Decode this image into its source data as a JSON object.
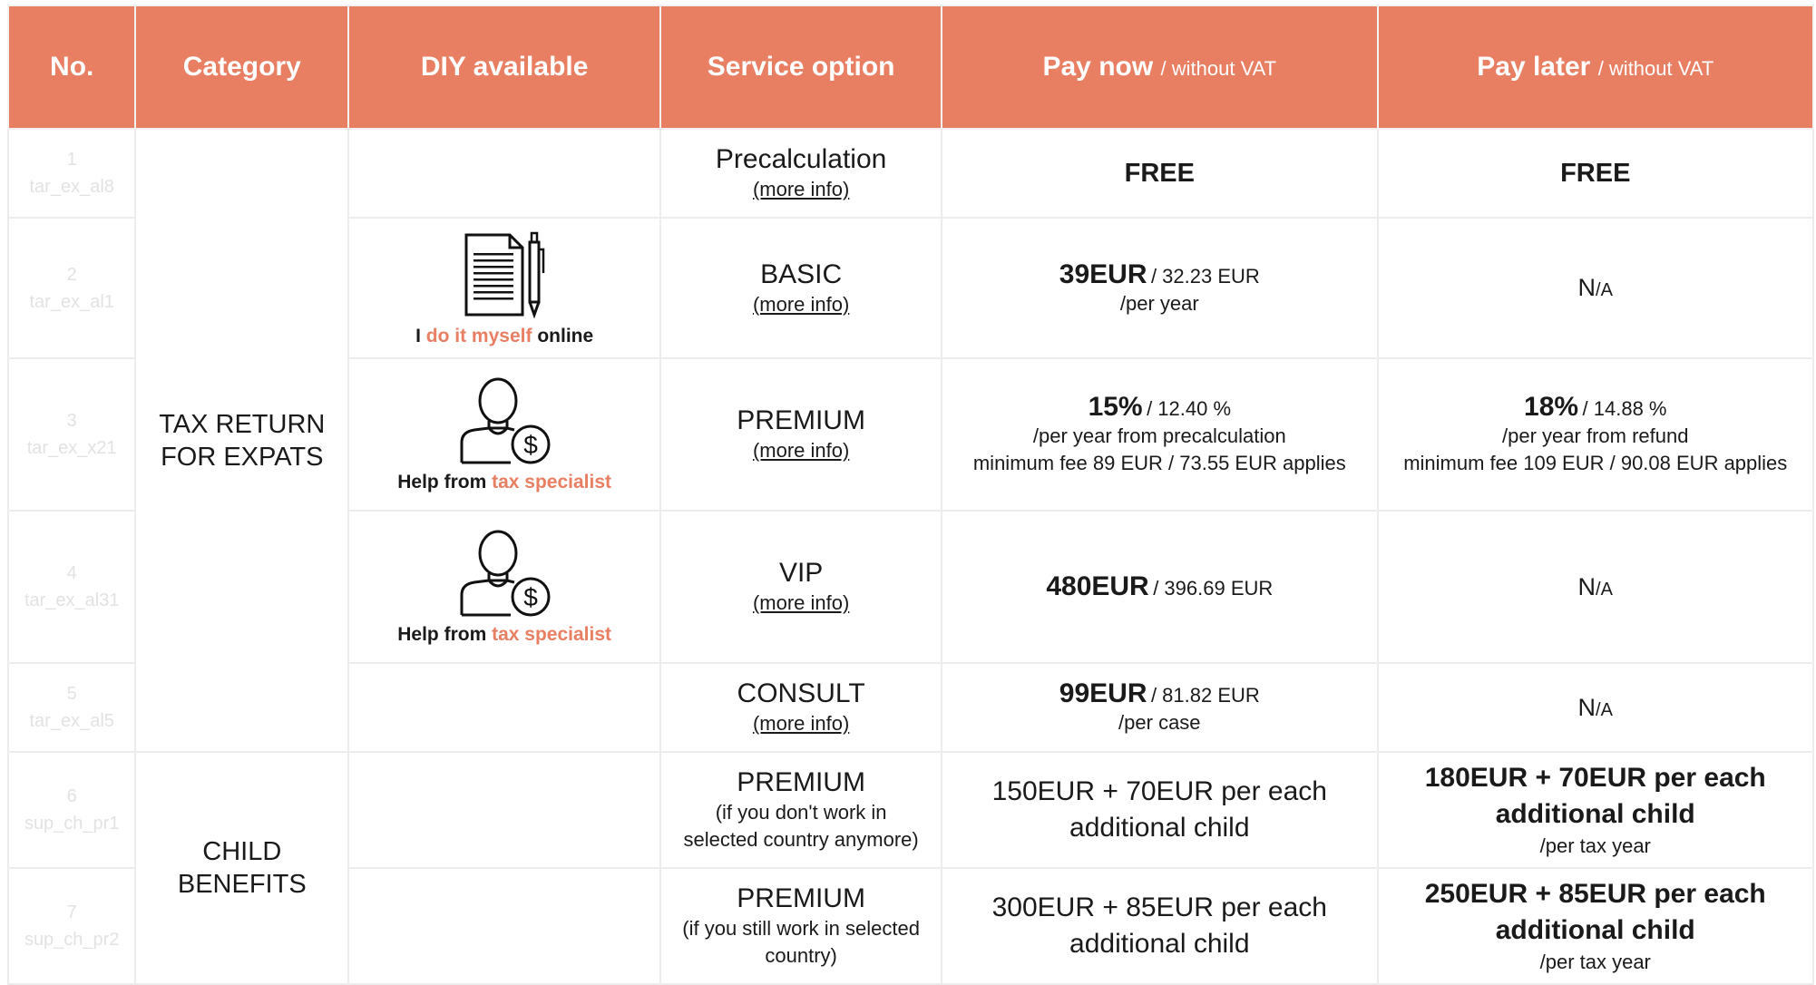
{
  "header": {
    "no": "No.",
    "category": "Category",
    "diy": "DIY available",
    "service": "Service option",
    "pay_now": "Pay now",
    "pay_now_sub": "/ without VAT",
    "pay_later": "Pay later",
    "pay_later_sub": "/ without VAT"
  },
  "categories": {
    "tax_line1": "TAX RETURN",
    "tax_line2": "FOR EXPATS",
    "child_line1": "CHILD",
    "child_line2": "BENEFITS"
  },
  "rows": [
    {
      "num": "1",
      "code": "tar_ex_al8",
      "service": "Precalculation",
      "more": "(more info)",
      "pay_now": "FREE",
      "pay_later": "FREE"
    },
    {
      "num": "2",
      "code": "tar_ex_al1",
      "service": "BASIC",
      "more": "(more info)",
      "pay_now_price": "39EUR",
      "pay_now_net": "/ 32.23 EUR",
      "pay_now_line": "/per year",
      "pay_later_na": "N",
      "pay_later_na_small": "/A"
    },
    {
      "num": "3",
      "code": "tar_ex_x21",
      "service": "PREMIUM",
      "more": "(more info)",
      "pay_now_price": "15%",
      "pay_now_net": "/ 12.40 %",
      "pay_now_line": "/per year from precalculation",
      "pay_now_line2": "minimum fee 89 EUR / 73.55 EUR applies",
      "pay_later_price": "18%",
      "pay_later_net": "/ 14.88 %",
      "pay_later_line": "/per year from refund",
      "pay_later_line2": "minimum fee 109 EUR / 90.08 EUR applies"
    },
    {
      "num": "4",
      "code": "tar_ex_al31",
      "service": "VIP",
      "more": "(more info)",
      "pay_now_price": "480EUR",
      "pay_now_net": "/ 396.69 EUR",
      "pay_later_na": "N",
      "pay_later_na_small": "/A"
    },
    {
      "num": "5",
      "code": "tar_ex_al5",
      "service": "CONSULT",
      "more": "(more info)",
      "pay_now_price": "99EUR",
      "pay_now_net": "/ 81.82 EUR",
      "pay_now_line": "/per case",
      "pay_later_na": "N",
      "pay_later_na_small": "/A"
    },
    {
      "num": "6",
      "code": "sup_ch_pr1",
      "service": "PREMIUM",
      "service_note1": "(if you don't work in",
      "service_note2": "selected country anymore)",
      "pay_now_l1": "150EUR + 70EUR per each",
      "pay_now_l2": "additional child",
      "pay_later_l1": "180EUR + 70EUR per each",
      "pay_later_l2": "additional child",
      "pay_later_line": "/per tax year"
    },
    {
      "num": "7",
      "code": "sup_ch_pr2",
      "service": "PREMIUM",
      "service_note1": "(if you still work in selected",
      "service_note2": "country)",
      "pay_now_l1": "300EUR + 85EUR per each",
      "pay_now_l2": "additional child",
      "pay_later_l1": "250EUR + 85EUR per each",
      "pay_later_l2": "additional child",
      "pay_later_line": "/per tax year"
    }
  ],
  "diy": {
    "self_pre": "I",
    "self_accent": "do it myself",
    "self_post": "online",
    "help_pre": "Help from",
    "help_accent": "tax specialist"
  },
  "colors": {
    "accent": "#e87e62",
    "border": "#ececec"
  }
}
